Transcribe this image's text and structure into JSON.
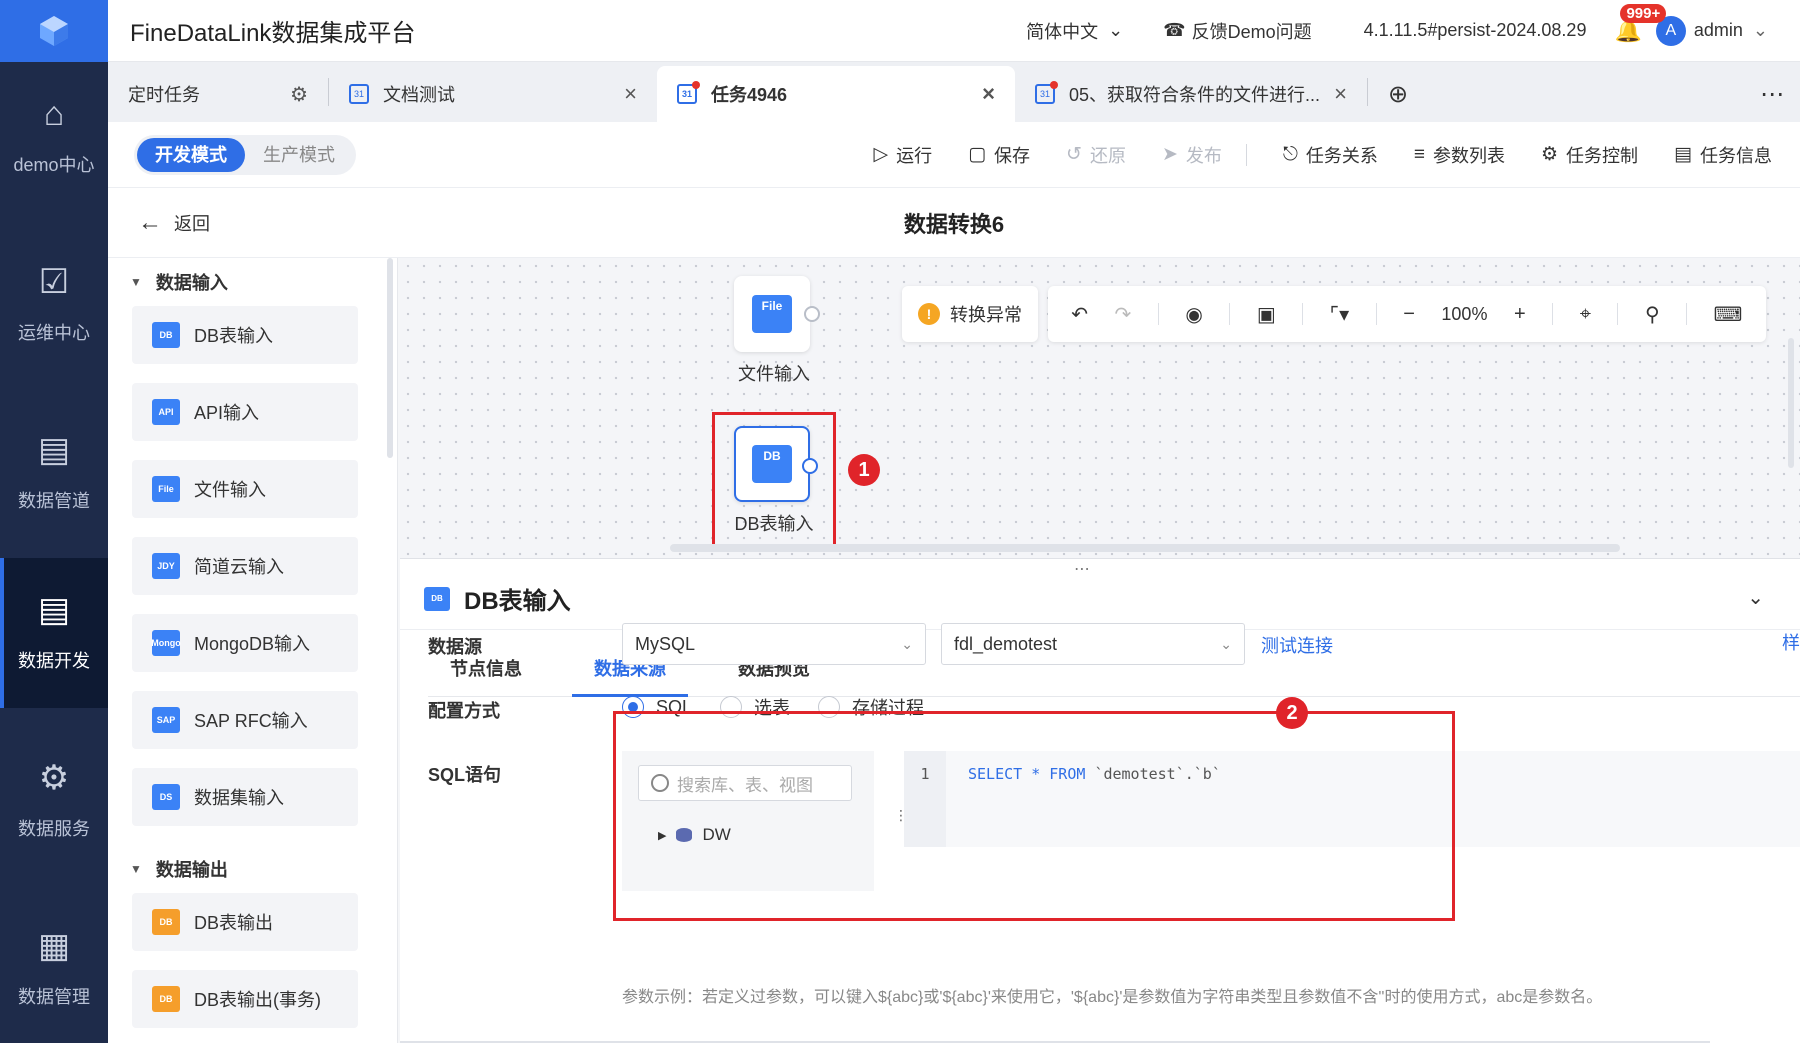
{
  "app": {
    "title": "FineDataLink数据集成平台",
    "language": "简体中文",
    "feedback": "反馈Demo问题",
    "version": "4.1.11.5#persist-2024.08.29",
    "notification_count": "999+",
    "user": "admin",
    "avatar_letter": "A"
  },
  "rail": {
    "items": [
      {
        "label": "demo中心",
        "icon": "home-icon"
      },
      {
        "label": "运维中心",
        "icon": "clipboard-check-icon"
      },
      {
        "label": "数据管道",
        "icon": "pipeline-icon"
      },
      {
        "label": "数据开发",
        "icon": "server-stack-icon"
      },
      {
        "label": "数据服务",
        "icon": "data-service-icon"
      },
      {
        "label": "数据管理",
        "icon": "data-manage-icon"
      }
    ]
  },
  "tabs": [
    {
      "label": "定时任务"
    },
    {
      "label": "文档测试"
    },
    {
      "label": "任务4946"
    },
    {
      "label": "05、获取符合条件的文件进行..."
    }
  ],
  "modes": {
    "dev": "开发模式",
    "prod": "生产模式"
  },
  "toolbar": {
    "run": "运行",
    "save": "保存",
    "restore": "还原",
    "publish": "发布",
    "task_relation": "任务关系",
    "param_list": "参数列表",
    "task_control": "任务控制",
    "task_info": "任务信息"
  },
  "titlebar": {
    "back": "返回",
    "flow_title": "数据转换6"
  },
  "palette": {
    "input_group": "数据输入",
    "inputs": [
      {
        "label": "DB表输入",
        "icon": "DB"
      },
      {
        "label": "API输入",
        "icon": "API"
      },
      {
        "label": "文件输入",
        "icon": "File"
      },
      {
        "label": "简道云输入",
        "icon": "JDY"
      },
      {
        "label": "MongoDB输入",
        "icon": "Mongo"
      },
      {
        "label": "SAP RFC输入",
        "icon": "SAP"
      },
      {
        "label": "数据集输入",
        "icon": "DS"
      }
    ],
    "output_group": "数据输出",
    "outputs": [
      {
        "label": "DB表输出",
        "icon": "DB"
      },
      {
        "label": "DB表输出(事务)",
        "icon": "DB"
      }
    ]
  },
  "canvas": {
    "nodes": [
      {
        "label": "文件输入",
        "icon": "File"
      },
      {
        "label": "DB表输入",
        "icon": "DB"
      }
    ],
    "warning": "转换异常",
    "zoom": "100%",
    "marker1": "1",
    "marker2": "2"
  },
  "config": {
    "title": "DB表输入",
    "tabs": [
      "节点信息",
      "数据来源",
      "数据预览"
    ],
    "datasource_label": "数据源",
    "datasource_type": "MySQL",
    "datasource_name": "fdl_demotest",
    "test_link": "测试连接",
    "truncated_link": "样",
    "config_method_label": "配置方式",
    "methods": [
      "SQL",
      "选表",
      "存储过程"
    ],
    "sql_label": "SQL语句",
    "search_placeholder": "搜索库、表、视图",
    "tree_item": "DW",
    "line_no": "1",
    "sql_keyword_1": "SELECT * FROM",
    "sql_table": "`demotest`.`b`",
    "hint": "参数示例：若定义过参数，可以键入${abc}或'${abc}'来使用它，'${abc}'是参数值为字符串类型且参数值不含''时的使用方式，abc是参数名。"
  }
}
